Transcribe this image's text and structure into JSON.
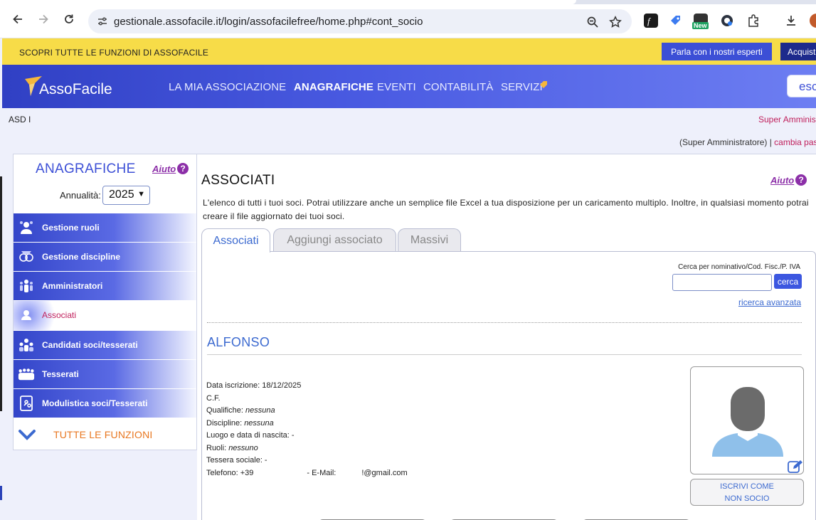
{
  "browser": {
    "url": "gestionale.assofacile.it/login/assofacilefree/home.php#cont_socio",
    "new_badge": "New"
  },
  "promo": {
    "text": "SCOPRI TUTTE LE FUNZIONI DI ASSOFACILE",
    "expert_button": "Parla con i nostri esperti",
    "buy_button": "Acquista"
  },
  "nav": {
    "logo_a": "Asso",
    "logo_b": "Facile",
    "items": [
      "LA MIA ASSOCIAZIONE",
      "ANAGRAFICHE",
      "EVENTI",
      "CONTABILITÀ",
      "SERVIZI"
    ],
    "active": "ANAGRAFICHE",
    "search_text": "esc"
  },
  "account": {
    "org": "ASD I",
    "role_top": "Super Amministratore",
    "role_line": "(Super Amministratore) | ",
    "role_link": "cambia password"
  },
  "sidebar": {
    "title": "ANAGRAFICHE",
    "help": "Aiuto",
    "year_label": "Annualità:",
    "year_value": "2025",
    "items": [
      {
        "label": "Gestione ruoli",
        "icon": "roles-icon"
      },
      {
        "label": "Gestione discipline",
        "icon": "disciplines-icon"
      },
      {
        "label": "Amministratori",
        "icon": "admins-icon"
      },
      {
        "label": "Associati",
        "icon": "member-icon",
        "active": true
      },
      {
        "label": "Candidati soci/tesserati",
        "icon": "candidates-icon"
      },
      {
        "label": "Tesserati",
        "icon": "members-group-icon"
      },
      {
        "label": "Modulistica soci/Tesserati",
        "icon": "forms-icon"
      }
    ],
    "all_functions": "TUTTE LE FUNZIONI"
  },
  "main": {
    "title": "ASSOCIATI",
    "help": "Aiuto",
    "intro": "L'elenco di tutti i tuoi soci. Potrai utilizzare anche un semplice file Excel a tua disposizione per un caricamento multiplo. Inoltre, in qualsiasi momento potrai creare il file aggiornato dei tuoi soci.",
    "tabs": [
      "Associati",
      "Aggiungi associato",
      "Massivi"
    ],
    "active_tab": "Associati",
    "search_label": "Cerca per nominativo/Cod. Fisc./P. IVA",
    "search_value": "",
    "search_button": "cerca",
    "advanced_search": "ricerca avanzata",
    "member": {
      "name": "ALFONSO",
      "registration_label": "Data iscrizione: ",
      "registration_date": "18/12/2025",
      "cf_label": "C.F.",
      "qualifiche_label": "Qualifiche: ",
      "qualifiche_value": "nessuna",
      "discipline_label": "Discipline: ",
      "discipline_value": "nessuna",
      "birth_label": "Luogo e data di nascita: -",
      "ruoli_label": "Ruoli: ",
      "ruoli_value": "nessuno",
      "tessera_label": "Tessera sociale: -",
      "phone_label": "Telefono: +39",
      "email_label": "- E-Mail:",
      "email_value": "!@gmail.com",
      "enroll_line1": "ISCRIVI COME",
      "enroll_line2": "NON SOCIO"
    }
  },
  "colors": {
    "accent": "#3c4fd6",
    "promo_bg": "#f7dc48",
    "link_pink": "#c0205c",
    "help_purple": "#8c2fa8",
    "orange": "#e87720"
  }
}
